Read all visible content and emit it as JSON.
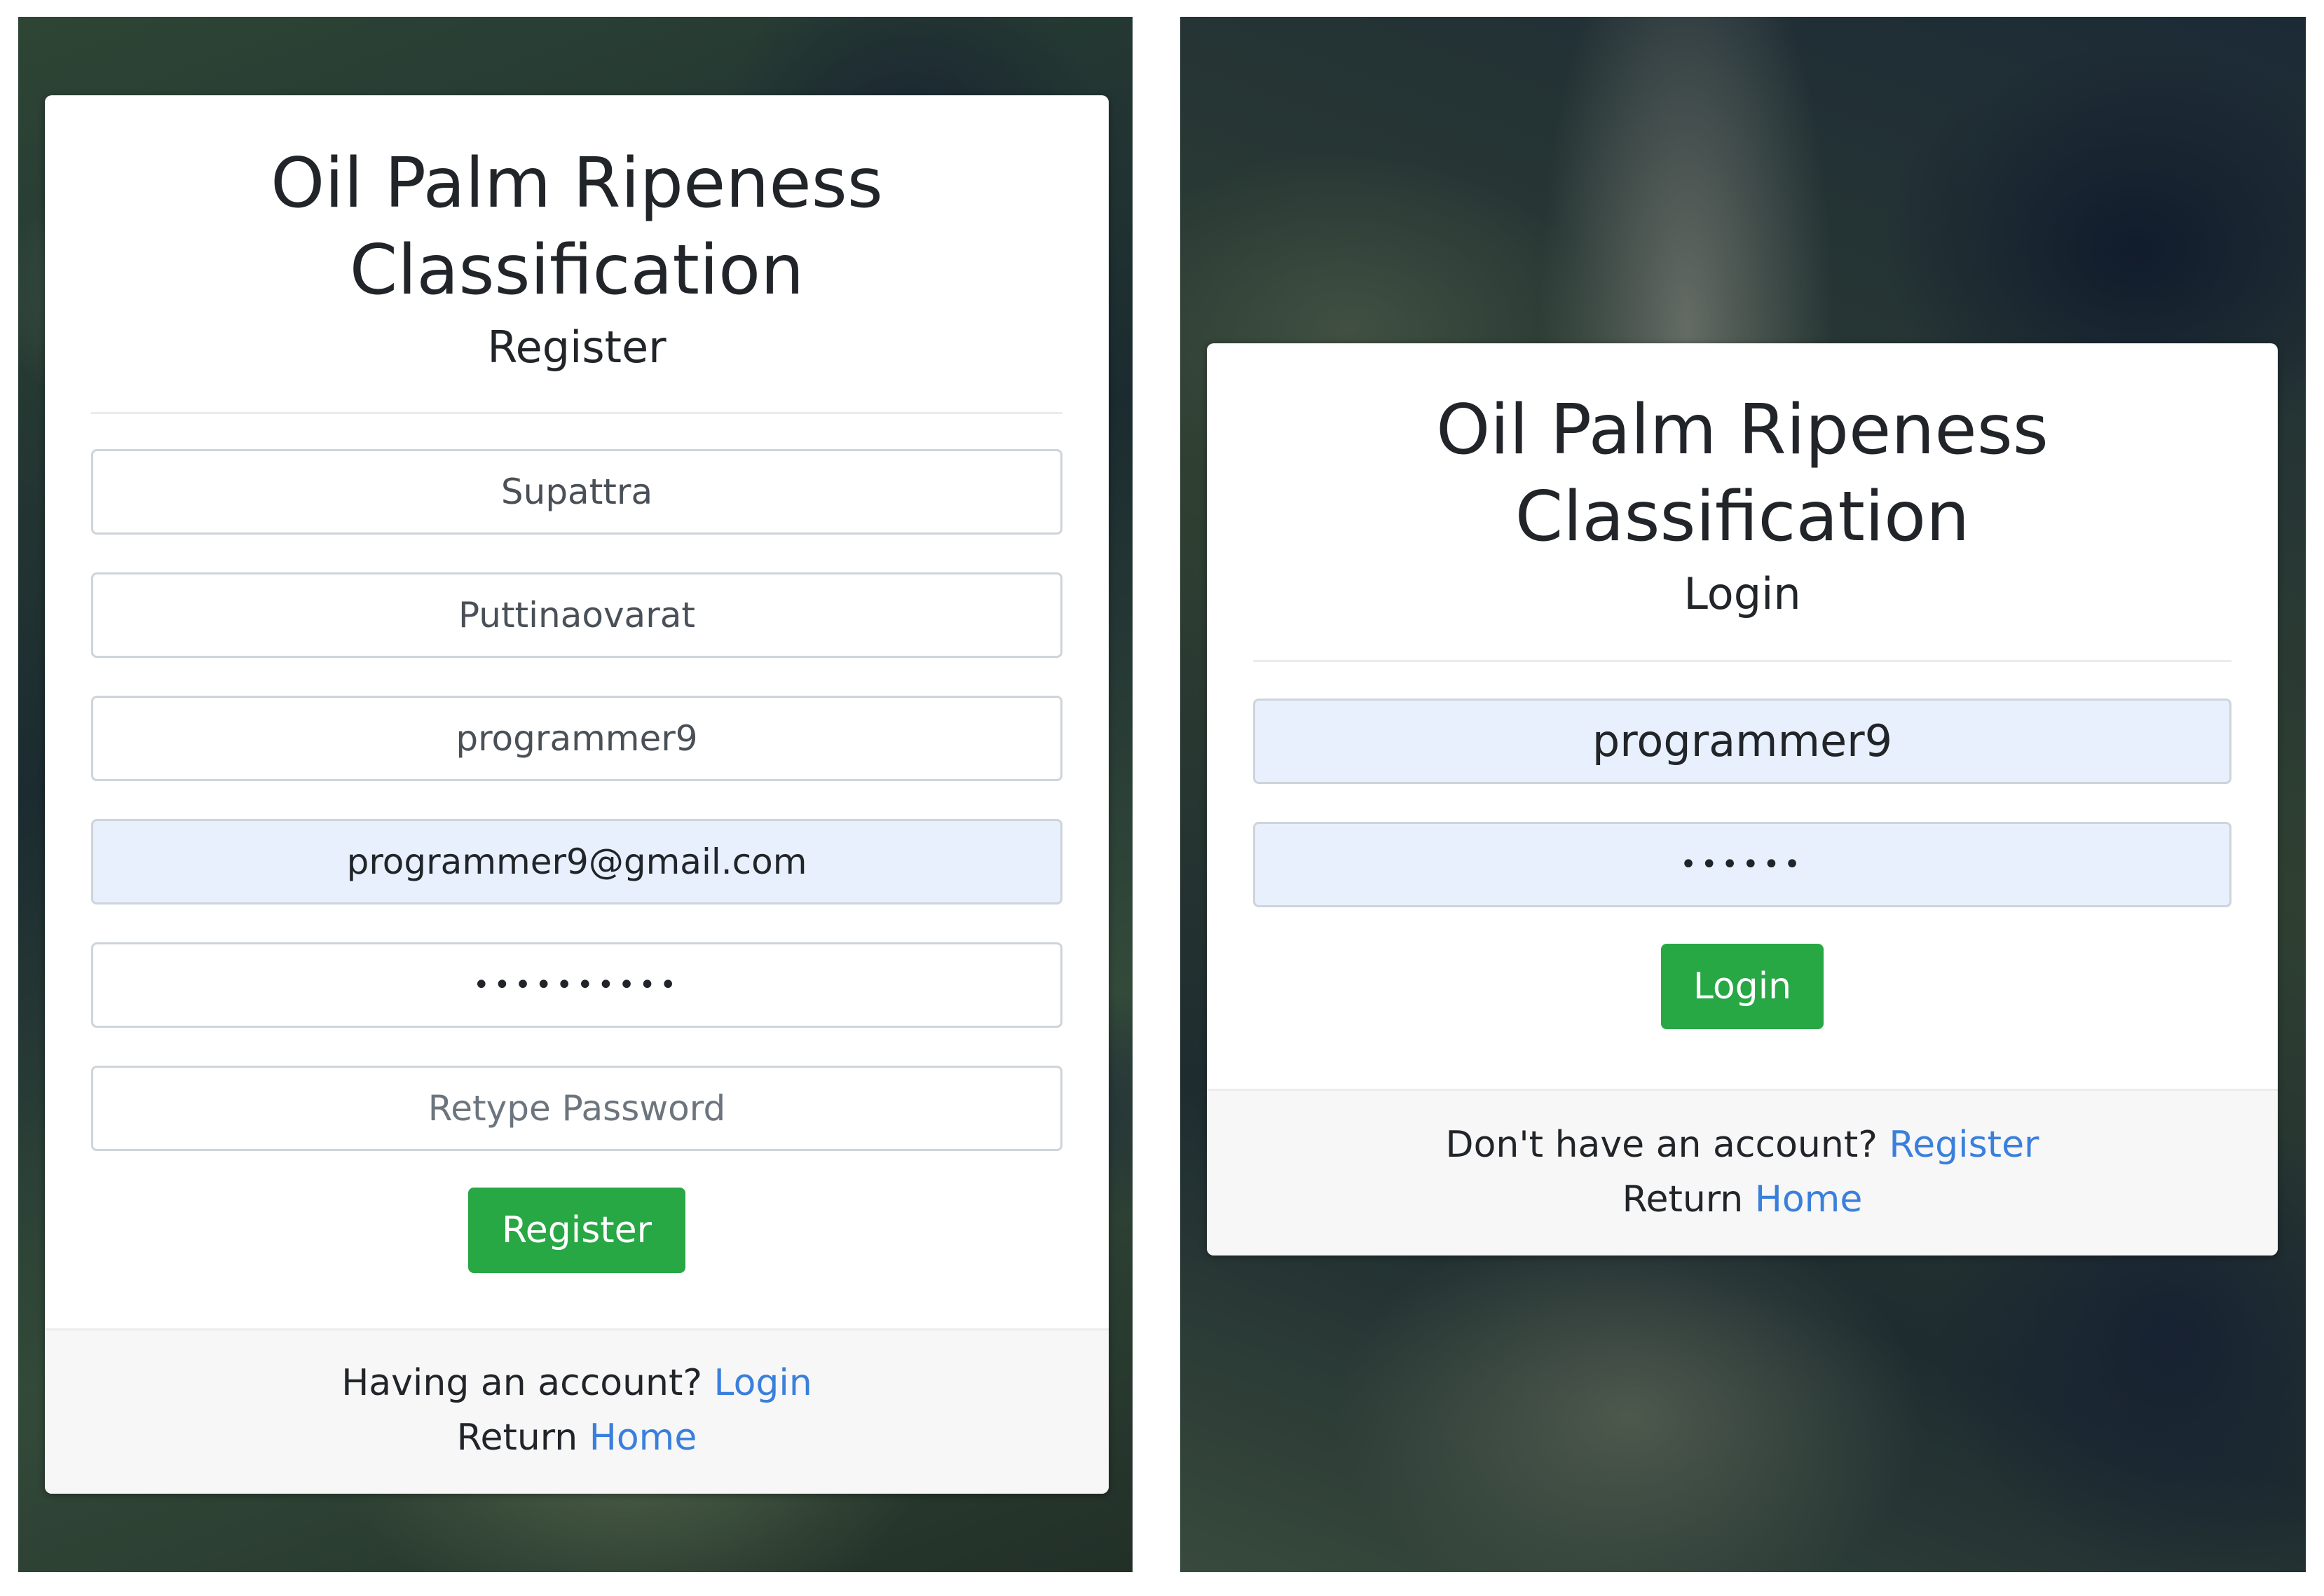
{
  "register_form": {
    "app_title_line1": "Oil Palm Ripeness",
    "app_title_line2": "Classification",
    "heading": "Register",
    "first_name_value": "Supattra",
    "last_name_value": "Puttinaovarat",
    "username_value": "programmer9",
    "email_value": "programmer9@gmail.com",
    "password_masked": "••••••••••",
    "retype_password_placeholder": "Retype Password",
    "submit_label": "Register",
    "footer": {
      "prompt_text": "Having an account?",
      "login_link": "Login",
      "return_text": "Return",
      "home_link": "Home"
    }
  },
  "login_form": {
    "app_title_line1": "Oil Palm Ripeness",
    "app_title_line2": "Classification",
    "heading": "Login",
    "username_value": "programmer9",
    "password_masked": "••••••",
    "submit_label": "Login",
    "footer": {
      "prompt_text": "Don't have an account?",
      "register_link": "Register",
      "return_text": "Return",
      "home_link": "Home"
    }
  },
  "colors": {
    "primary_button": "#28a745",
    "link": "#3a7fdc",
    "autofill_background": "#e8f0fe",
    "footer_background": "#f7f7f7"
  }
}
